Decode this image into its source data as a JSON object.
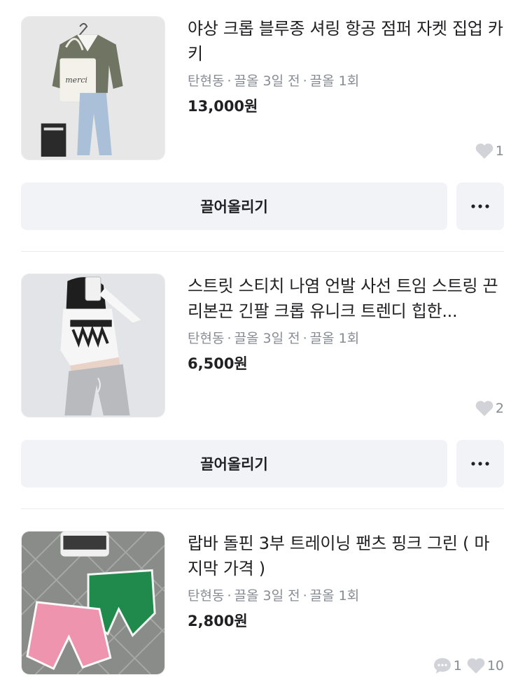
{
  "listings": [
    {
      "title": "야상 크롭 블루종 셔링 항공 점퍼 자켓 집업 카키",
      "location": "탄현동",
      "time": "끌올 3일 전",
      "bumps": "끌올 1회",
      "price": "13,000원",
      "likes": "1",
      "image_icon": "jacket-photo"
    },
    {
      "title": "스트릿 스티치 나염 언발 사선 트임 스트링 끈 리본끈 긴팔 크롭 유니크 트렌디 힙한...",
      "location": "탄현동",
      "time": "끌올 3일 전",
      "bumps": "끌올 1회",
      "price": "6,500원",
      "likes": "2",
      "image_icon": "crop-top-photo"
    },
    {
      "title": "랍바 돌핀 3부 트레이닝 팬츠 핑크 그린 ( 마지막 가격 )",
      "location": "탄현동",
      "time": "끌올 3일 전",
      "bumps": "끌올 1회",
      "price": "2,800원",
      "chats": "1",
      "likes": "10",
      "image_icon": "shorts-photo"
    }
  ],
  "actions": {
    "bump_label": "끌어올리기",
    "more_icon": "more-dots-icon"
  },
  "separator": "·",
  "colors": {
    "text": "#212124",
    "muted": "#868b94",
    "button_bg": "#f2f3f6",
    "divider": "#e9ecef"
  }
}
